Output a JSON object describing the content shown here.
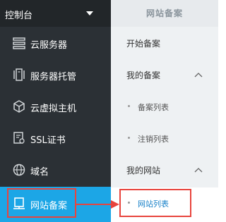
{
  "sidebar": {
    "header": {
      "title": "控制台"
    },
    "items": [
      {
        "label": "云服务器",
        "icon": "server-list-icon"
      },
      {
        "label": "服务器托管",
        "icon": "server-rack-icon"
      },
      {
        "label": "云虚拟主机",
        "icon": "cube-icon"
      },
      {
        "label": "SSL证书",
        "icon": "certificate-icon"
      },
      {
        "label": "域名",
        "icon": "globe-icon"
      },
      {
        "label": "网站备案",
        "icon": "website-record-icon",
        "active": true
      }
    ]
  },
  "subnav": {
    "title": "网站备案",
    "items": [
      {
        "label": "开始备案"
      },
      {
        "label": "我的备案",
        "expanded": true
      },
      {
        "label": "备案列表",
        "child": true
      },
      {
        "label": "注销列表",
        "child": true
      },
      {
        "label": "我的网站",
        "expanded": true
      },
      {
        "label": "网站列表",
        "child": true,
        "active": true
      }
    ]
  },
  "colors": {
    "sidebar_bg": "#2b3035",
    "sidebar_header_bg": "#222629",
    "active_blue": "#1ca6e6",
    "subnav_bg": "#eef1f3",
    "highlight_red": "#e8443d",
    "link_blue": "#1a82c9"
  }
}
